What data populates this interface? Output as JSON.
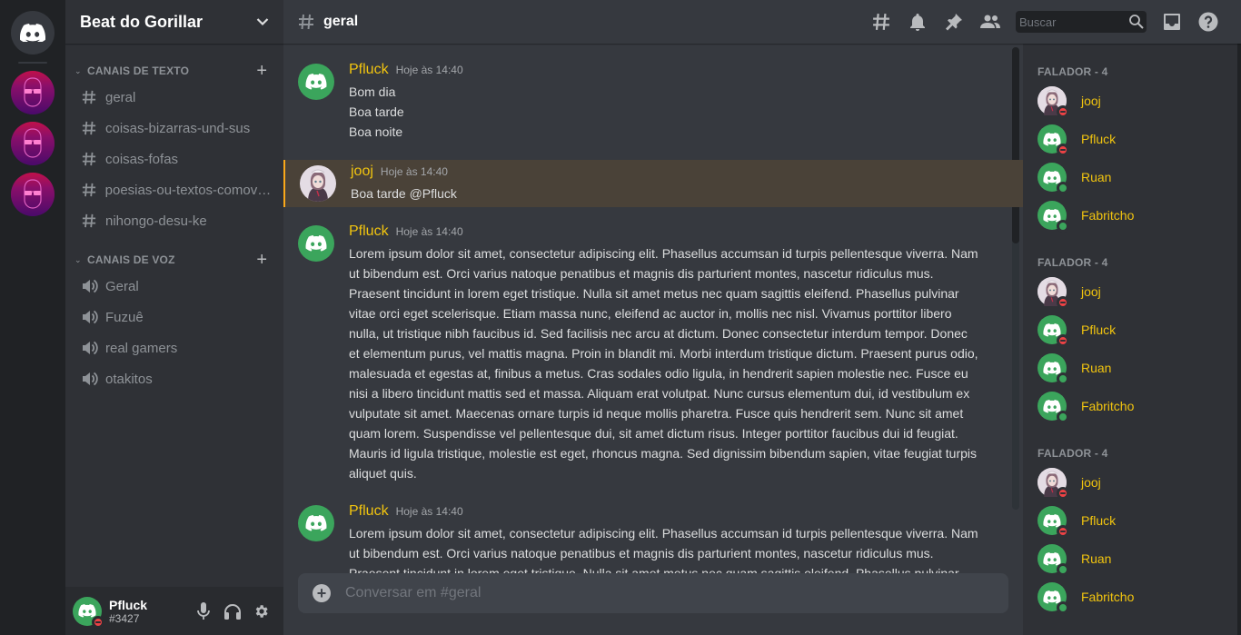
{
  "servers": {
    "home_icon": "discord-logo-icon",
    "items": [
      {
        "name": "server-1"
      },
      {
        "name": "server-2"
      },
      {
        "name": "server-3"
      }
    ]
  },
  "guild": {
    "name": "Beat do Gorillar",
    "dropdown_icon": "chevron-down-icon"
  },
  "categories": {
    "text": {
      "label": "CANAIS DE TEXTO",
      "channels": [
        {
          "label": "geral"
        },
        {
          "label": "coisas-bizarras-und-sus"
        },
        {
          "label": "coisas-fofas"
        },
        {
          "label": "poesias-ou-textos-comove…"
        },
        {
          "label": "nihongo-desu-ke"
        }
      ]
    },
    "voice": {
      "label": "CANAIS DE VOZ",
      "channels": [
        {
          "label": "Geral"
        },
        {
          "label": "Fuzuê"
        },
        {
          "label": "real gamers"
        },
        {
          "label": "otakitos"
        }
      ]
    }
  },
  "user_panel": {
    "name": "Pfluck",
    "tag": "#3427",
    "status": "dnd"
  },
  "topbar": {
    "channel": "geral",
    "search_placeholder": "Buscar",
    "icons": [
      "threads-icon",
      "bell-icon",
      "pin-icon",
      "members-icon",
      "inbox-icon",
      "help-icon"
    ]
  },
  "messages": [
    {
      "author": "Pfluck",
      "timestamp": "Hoje às 14:40",
      "avatar": "discord",
      "mention": false,
      "lines": [
        "Bom dia",
        "Boa tarde",
        "Boa noite"
      ]
    },
    {
      "author": "jooj",
      "timestamp": "Hoje às 14:40",
      "avatar": "picture",
      "mention": true,
      "lines": [
        "Boa tarde @Pfluck"
      ]
    },
    {
      "author": "Pfluck",
      "timestamp": "Hoje às 14:40",
      "avatar": "discord",
      "mention": false,
      "lines": [
        "Lorem ipsum dolor sit amet, consectetur adipiscing elit. Phasellus accumsan id turpis pellentesque viverra. Nam ut bibendum est. Orci varius natoque penatibus et magnis dis parturient montes, nascetur ridiculus mus. Praesent tincidunt in lorem eget tristique. Nulla sit amet metus nec quam sagittis eleifend. Phasellus pulvinar vitae orci eget scelerisque. Etiam massa nunc, eleifend ac auctor in, mollis nec nisl. Vivamus porttitor libero nulla, ut tristique nibh faucibus id. Sed facilisis nec arcu at dictum. Donec consectetur interdum tempor. Donec et elementum purus, vel mattis magna. Proin in blandit mi. Morbi interdum tristique dictum. Praesent purus odio, malesuada et egestas at, finibus a metus. Cras sodales odio ligula, in hendrerit sapien molestie nec. Fusce eu nisi a libero tincidunt mattis sed et massa. Aliquam erat volutpat. Nunc cursus elementum dui, id vestibulum ex vulputate sit amet. Maecenas ornare turpis id neque mollis pharetra. Fusce quis hendrerit sem. Nunc sit amet quam lorem. Suspendisse vel pellentesque dui, sit amet dictum risus. Integer porttitor faucibus dui id feugiat. Mauris id ligula tristique, molestie est eget, rhoncus magna. Sed dignissim bibendum sapien, vitae feugiat turpis aliquet quis."
      ]
    },
    {
      "author": "Pfluck",
      "timestamp": "Hoje às 14:40",
      "avatar": "discord",
      "mention": false,
      "lines": [
        "Lorem ipsum dolor sit amet, consectetur adipiscing elit. Phasellus accumsan id turpis pellentesque viverra. Nam ut bibendum est. Orci varius natoque penatibus et magnis dis parturient montes, nascetur ridiculus mus. Praesent tincidunt in lorem eget tristique. Nulla sit amet metus nec quam sagittis eleifend. Phasellus pulvinar"
      ]
    }
  ],
  "composer": {
    "placeholder": "Conversar em #geral"
  },
  "members": {
    "groups": [
      {
        "title": "FALADOR - 4",
        "members": [
          {
            "name": "jooj",
            "avatar": "picture",
            "status": "dnd"
          },
          {
            "name": "Pfluck",
            "avatar": "discord",
            "status": "dnd"
          },
          {
            "name": "Ruan",
            "avatar": "discord",
            "status": "online"
          },
          {
            "name": "Fabritcho",
            "avatar": "discord",
            "status": "online"
          }
        ]
      },
      {
        "title": "FALADOR - 4",
        "members": [
          {
            "name": "jooj",
            "avatar": "picture",
            "status": "dnd"
          },
          {
            "name": "Pfluck",
            "avatar": "discord",
            "status": "dnd"
          },
          {
            "name": "Ruan",
            "avatar": "discord",
            "status": "online"
          },
          {
            "name": "Fabritcho",
            "avatar": "discord",
            "status": "online"
          }
        ]
      },
      {
        "title": "FALADOR - 4",
        "members": [
          {
            "name": "jooj",
            "avatar": "picture",
            "status": "dnd"
          },
          {
            "name": "Pfluck",
            "avatar": "discord",
            "status": "dnd"
          },
          {
            "name": "Ruan",
            "avatar": "discord",
            "status": "online"
          },
          {
            "name": "Fabritcho",
            "avatar": "discord",
            "status": "online"
          }
        ]
      }
    ]
  },
  "colors": {
    "username": "#f1c40f",
    "online": "#3ba55c",
    "dnd": "#ed4245",
    "mention_bar": "#faa81a"
  }
}
